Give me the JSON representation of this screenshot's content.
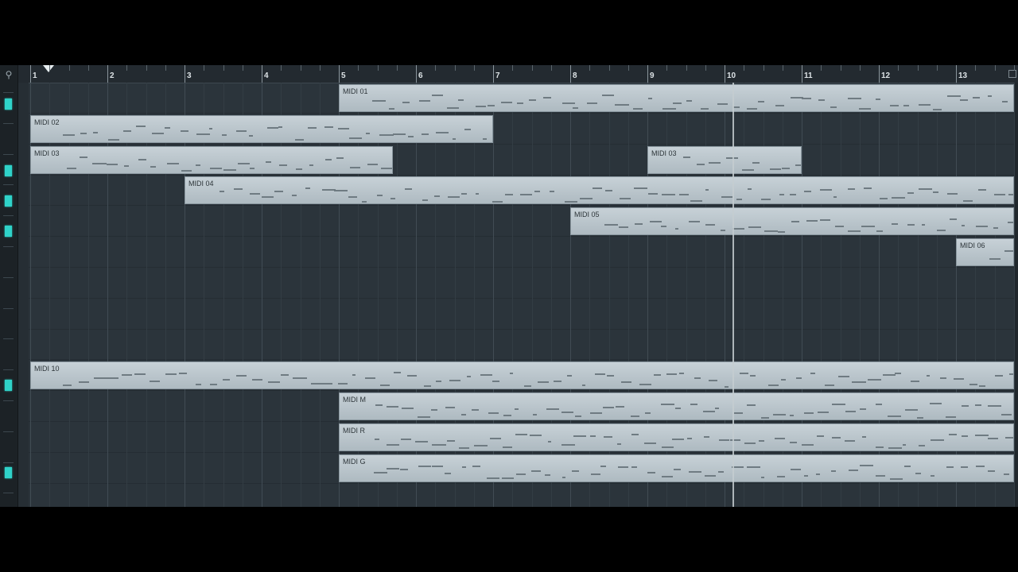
{
  "ruler": {
    "bars": [
      "1",
      "2",
      "3",
      "4",
      "5",
      "6",
      "7",
      "8",
      "9",
      "10",
      "11",
      "12",
      "13"
    ]
  },
  "left_strip": {
    "search_icon": "search-icon",
    "meters": [
      {
        "level": 1,
        "active": true
      },
      {
        "level": 1,
        "active": true
      },
      {
        "level": 1,
        "active": true
      },
      {
        "level": 1,
        "active": true
      },
      {
        "level": 1,
        "active": true
      },
      {
        "level": 1,
        "active": true
      }
    ]
  },
  "parts": [
    {
      "id": "p1",
      "label": "MIDI 01",
      "track": 0,
      "start_bar": 5.0,
      "end_bar": 13.75
    },
    {
      "id": "p2",
      "label": "MIDI 02",
      "track": 1,
      "start_bar": 1.0,
      "end_bar": 7.0
    },
    {
      "id": "p3",
      "label": "MIDI 03",
      "track": 2,
      "start_bar": 1.0,
      "end_bar": 5.7
    },
    {
      "id": "p4",
      "label": "MIDI 03",
      "track": 2,
      "start_bar": 9.0,
      "end_bar": 11.0
    },
    {
      "id": "p5",
      "label": "MIDI 04",
      "track": 3,
      "start_bar": 3.0,
      "end_bar": 13.75
    },
    {
      "id": "p6",
      "label": "MIDI 05",
      "track": 4,
      "start_bar": 8.0,
      "end_bar": 13.75
    },
    {
      "id": "p7",
      "label": "MIDI 06",
      "track": 5,
      "start_bar": 13.0,
      "end_bar": 13.75
    },
    {
      "id": "p8",
      "label": "MIDI 10",
      "track": 9,
      "start_bar": 1.0,
      "end_bar": 13.75
    },
    {
      "id": "p9",
      "label": "MIDI M",
      "track": 10,
      "start_bar": 5.0,
      "end_bar": 13.75
    },
    {
      "id": "p10",
      "label": "MIDI R",
      "track": 11,
      "start_bar": 5.0,
      "end_bar": 13.75
    },
    {
      "id": "p11",
      "label": "MIDI G",
      "track": 12,
      "start_bar": 5.0,
      "end_bar": 13.75
    }
  ],
  "playhead_bar": 10.1
}
